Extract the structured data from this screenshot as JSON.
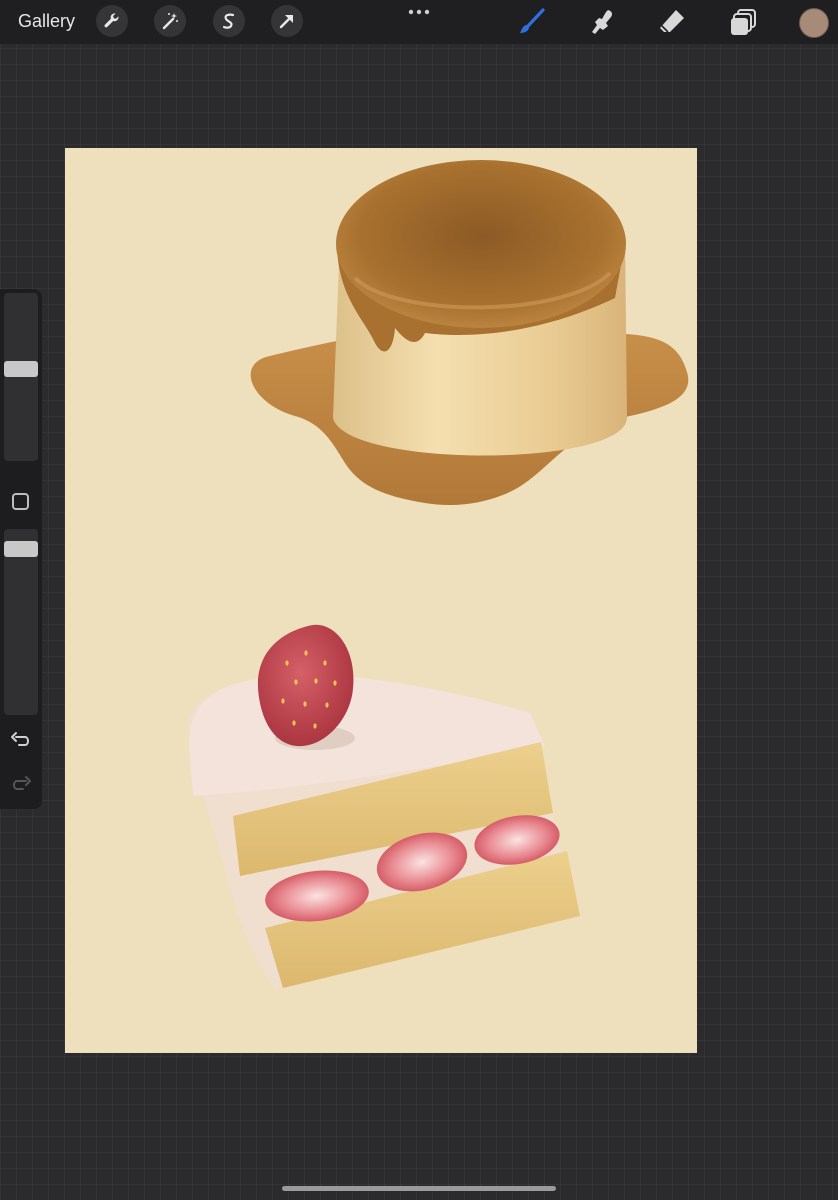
{
  "topbar": {
    "gallery_label": "Gallery",
    "tools": [
      "wrench-icon",
      "magic-wand-icon",
      "selection-s-icon",
      "transform-arrow-icon"
    ],
    "more_label": "•••",
    "right_tools": [
      "brush-icon",
      "smudge-icon",
      "eraser-icon",
      "layers-icon"
    ],
    "active_tool": "brush-icon",
    "active_color": "#a88a79",
    "accent_color": "#2f6fe0"
  },
  "sidebar": {
    "brush_size_level": 0.55,
    "opacity_level": 0.93,
    "controls": [
      "brush-size-slider",
      "modify-button",
      "opacity-slider",
      "undo-icon",
      "redo-icon"
    ]
  },
  "canvas": {
    "background_color": "#eedfbd",
    "subjects": [
      "pudding",
      "strawberry-shortcake-slice"
    ]
  }
}
